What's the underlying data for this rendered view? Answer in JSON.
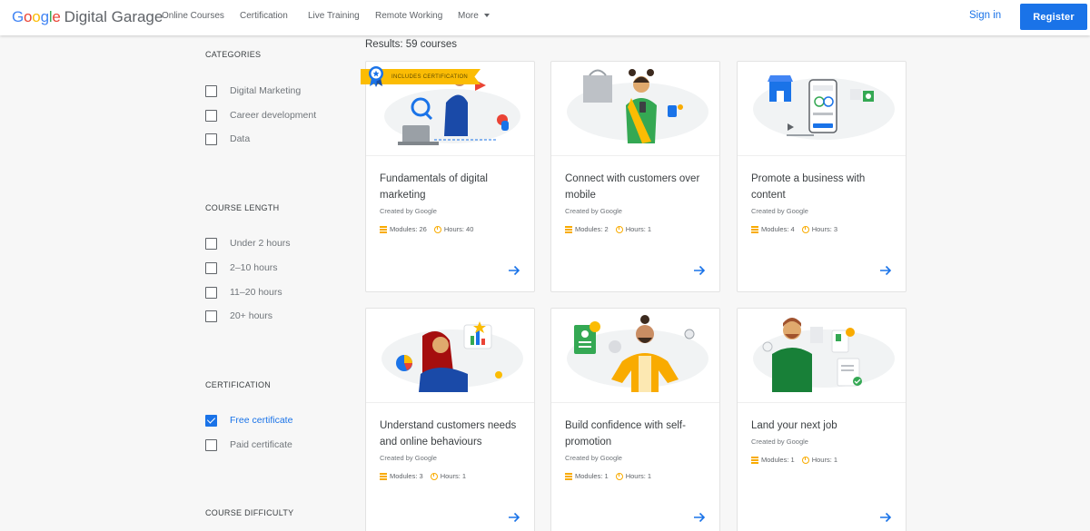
{
  "header": {
    "logo_google": "Google",
    "logo_rest": "Digital Garage",
    "nav": [
      "Online Courses",
      "Certification",
      "Live Training",
      "Remote Working",
      "More"
    ],
    "sign_in": "Sign in",
    "register": "Register"
  },
  "sidebar": {
    "categories_title": "CATEGORIES",
    "categories": [
      "Digital Marketing",
      "Career development",
      "Data"
    ],
    "length_title": "COURSE LENGTH",
    "lengths": [
      "Under 2 hours",
      "2–10 hours",
      "11–20 hours",
      "20+ hours"
    ],
    "certification_title": "CERTIFICATION",
    "certifications": [
      {
        "label": "Free certificate",
        "checked": true
      },
      {
        "label": "Paid certificate",
        "checked": false
      }
    ],
    "difficulty_title": "COURSE DIFFICULTY"
  },
  "results": "Results: 59 courses",
  "badge": "INCLUDES CERTIFICATION",
  "cards": [
    {
      "title": "Fundamentals of digital marketing",
      "creator": "Created by Google",
      "modules": "Modules: 26",
      "hours": "Hours: 40"
    },
    {
      "title": "Connect with customers over mobile",
      "creator": "Created by Google",
      "modules": "Modules: 2",
      "hours": "Hours: 1"
    },
    {
      "title": "Promote a business with content",
      "creator": "Created by Google",
      "modules": "Modules: 4",
      "hours": "Hours: 3"
    },
    {
      "title": "Understand customers needs and online behaviours",
      "creator": "Created by Google",
      "modules": "Modules: 3",
      "hours": "Hours: 1"
    },
    {
      "title": "Build confidence with self-promotion",
      "creator": "Created by Google",
      "modules": "Modules: 1",
      "hours": "Hours: 1"
    },
    {
      "title": "Land your next job",
      "creator": "Created by Google",
      "modules": "Modules: 1",
      "hours": "Hours: 1"
    }
  ],
  "colors": {
    "accent": "#1a73e8",
    "meta_icon": "#f9ab00",
    "badge": "#fbbc04"
  }
}
